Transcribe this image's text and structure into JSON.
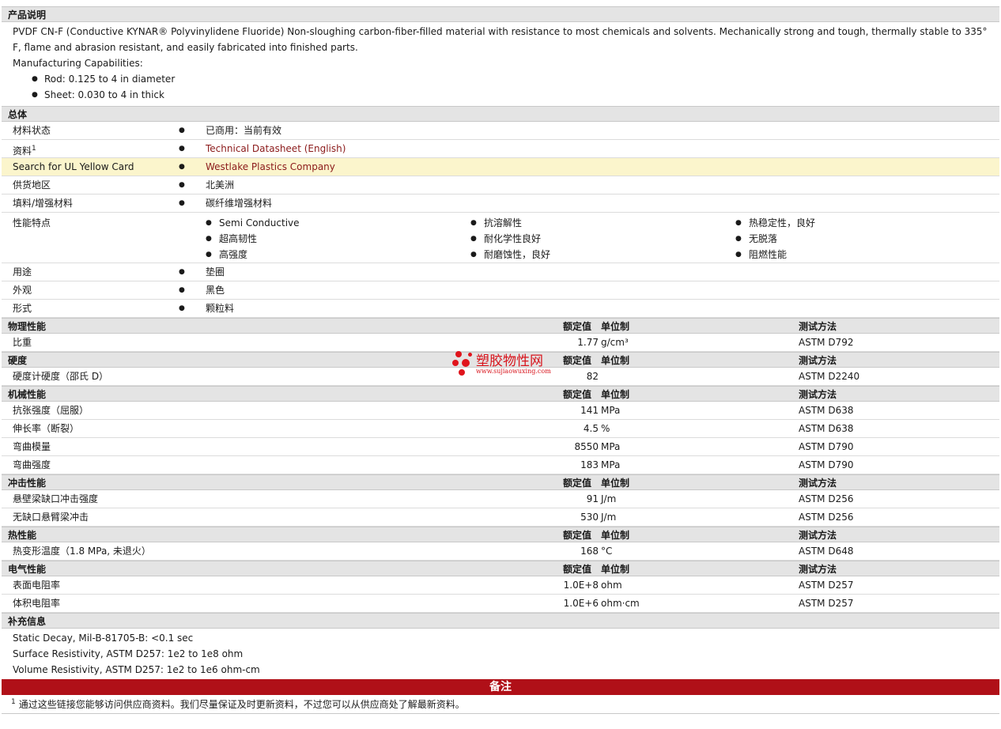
{
  "product": {
    "header": "产品说明",
    "description": "PVDF CN-F (Conductive KYNAR® Polyvinylidene Fluoride) Non-sloughing carbon-fiber-filled material with resistance to most chemicals and solvents. Mechanically strong and tough, thermally stable to 335° F, flame and abrasion resistant, and easily fabricated into finished parts.",
    "capabilities_label": "Manufacturing Capabilities:",
    "capabilities": [
      "Rod: 0.125 to 4 in diameter",
      "Sheet: 0.030 to 4 in thick"
    ]
  },
  "general": {
    "header": "总体",
    "rows": [
      {
        "label": "材料状态",
        "value": "已商用：当前有效"
      },
      {
        "label": "资料",
        "sup": "1",
        "value": "Technical Datasheet (English)"
      },
      {
        "label": "Search for UL Yellow Card",
        "value": "Westlake Plastics Company"
      },
      {
        "label": "供货地区",
        "value": "北美洲"
      },
      {
        "label": "填料/增强材料",
        "value": "碳纤维增强材料"
      }
    ],
    "features_label": "性能特点",
    "features": [
      [
        "Semi Conductive",
        "超高韧性",
        "高强度"
      ],
      [
        "抗溶解性",
        "耐化学性良好",
        "耐磨蚀性，良好"
      ],
      [
        "热稳定性，良好",
        "无脱落",
        "阻燃性能"
      ]
    ],
    "rows2": [
      {
        "label": "用途",
        "value": "垫圈"
      },
      {
        "label": "外观",
        "value": "黑色"
      },
      {
        "label": "形式",
        "value": "颗粒料"
      }
    ]
  },
  "columns": {
    "nominal": "额定值",
    "unit": "单位制",
    "method": "测试方法"
  },
  "sections": [
    {
      "header": "物理性能",
      "rows": [
        {
          "name": "比重",
          "value": "1.77",
          "unit": "g/cm³",
          "method": "ASTM D792"
        }
      ]
    },
    {
      "header": "硬度",
      "rows": [
        {
          "name": "硬度计硬度（邵氏 D）",
          "value": "82",
          "unit": "",
          "method": "ASTM D2240"
        }
      ]
    },
    {
      "header": "机械性能",
      "rows": [
        {
          "name": "抗张强度（屈服）",
          "value": "141",
          "unit": "MPa",
          "method": "ASTM D638"
        },
        {
          "name": "伸长率（断裂）",
          "value": "4.5",
          "unit": "%",
          "method": "ASTM D638"
        },
        {
          "name": "弯曲模量",
          "value": "8550",
          "unit": "MPa",
          "method": "ASTM D790"
        },
        {
          "name": "弯曲强度",
          "value": "183",
          "unit": "MPa",
          "method": "ASTM D790"
        }
      ]
    },
    {
      "header": "冲击性能",
      "rows": [
        {
          "name": "悬壁梁缺口冲击强度",
          "value": "91",
          "unit": "J/m",
          "method": "ASTM D256"
        },
        {
          "name": "无缺口悬臂梁冲击",
          "value": "530",
          "unit": "J/m",
          "method": "ASTM D256"
        }
      ]
    },
    {
      "header": "热性能",
      "rows": [
        {
          "name": "热变形温度（1.8 MPa, 未退火）",
          "value": "168",
          "unit": "°C",
          "method": "ASTM D648"
        }
      ]
    },
    {
      "header": "电气性能",
      "rows": [
        {
          "name": "表面电阻率",
          "value": "1.0E+8",
          "unit": "ohm",
          "method": "ASTM D257"
        },
        {
          "name": "体积电阻率",
          "value": "1.0E+6",
          "unit": "ohm·cm",
          "method": "ASTM D257"
        }
      ]
    }
  ],
  "supplemental": {
    "header": "补充信息",
    "lines": [
      "Static Decay, Mil-B-81705-B: <0.1 sec",
      "Surface Resistivity, ASTM D257: 1e2 to 1e8 ohm",
      "Volume Resistivity, ASTM D257: 1e2 to 1e6 ohm-cm"
    ]
  },
  "notes": {
    "header": "备注",
    "sup": "1",
    "text": "通过这些链接您能够访问供应商资料。我们尽量保证及时更新资料，不过您可以从供应商处了解最新资料。"
  },
  "watermark": {
    "title": "塑胶物性网",
    "url": "www.sujiaowuxing.com"
  },
  "colors": {
    "header_bg": "#e4e4e4",
    "highlight": "#fbf5cc",
    "link": "#8b1a1a",
    "notes_bar": "#b01018"
  }
}
